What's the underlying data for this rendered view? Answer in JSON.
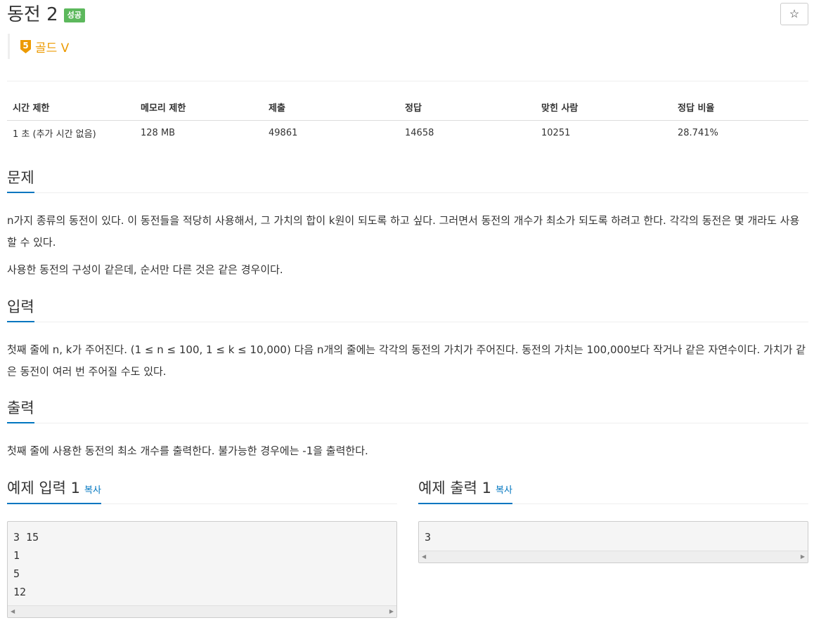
{
  "problem": {
    "title": "동전 2",
    "status_badge": "성공",
    "tier_number": "5",
    "tier_label": "골드 V",
    "star": "☆"
  },
  "stats": {
    "headers": [
      "시간 제한",
      "메모리 제한",
      "제출",
      "정답",
      "맞힌 사람",
      "정답 비율"
    ],
    "values": [
      "1 초 (추가 시간 없음)",
      "128 MB",
      "49861",
      "14658",
      "10251",
      "28.741%"
    ]
  },
  "sections": {
    "problem_title": "문제",
    "problem_p1": "n가지 종류의 동전이 있다. 이 동전들을 적당히 사용해서, 그 가치의 합이 k원이 되도록 하고 싶다. 그러면서 동전의 개수가 최소가 되도록 하려고 한다. 각각의 동전은 몇 개라도 사용할 수 있다.",
    "problem_p2": "사용한 동전의 구성이 같은데, 순서만 다른 것은 같은 경우이다.",
    "input_title": "입력",
    "input_p": "첫째 줄에 n, k가 주어진다. (1 ≤ n ≤ 100, 1 ≤ k ≤ 10,000) 다음 n개의 줄에는 각각의 동전의 가치가 주어진다. 동전의 가치는 100,000보다 작거나 같은 자연수이다. 가치가 같은 동전이 여러 번 주어질 수도 있다.",
    "output_title": "출력",
    "output_p": "첫째 줄에 사용한 동전의 최소 개수를 출력한다. 불가능한 경우에는 -1을 출력한다."
  },
  "samples": {
    "input_title": "예제 입력 1",
    "output_title": "예제 출력 1",
    "copy_label": "복사",
    "input_text": "3 15\n1\n5\n12",
    "output_text": "3"
  },
  "colors": {
    "accent": "#0076c0",
    "success": "#5cb85c",
    "gold": "#ec9a00"
  }
}
